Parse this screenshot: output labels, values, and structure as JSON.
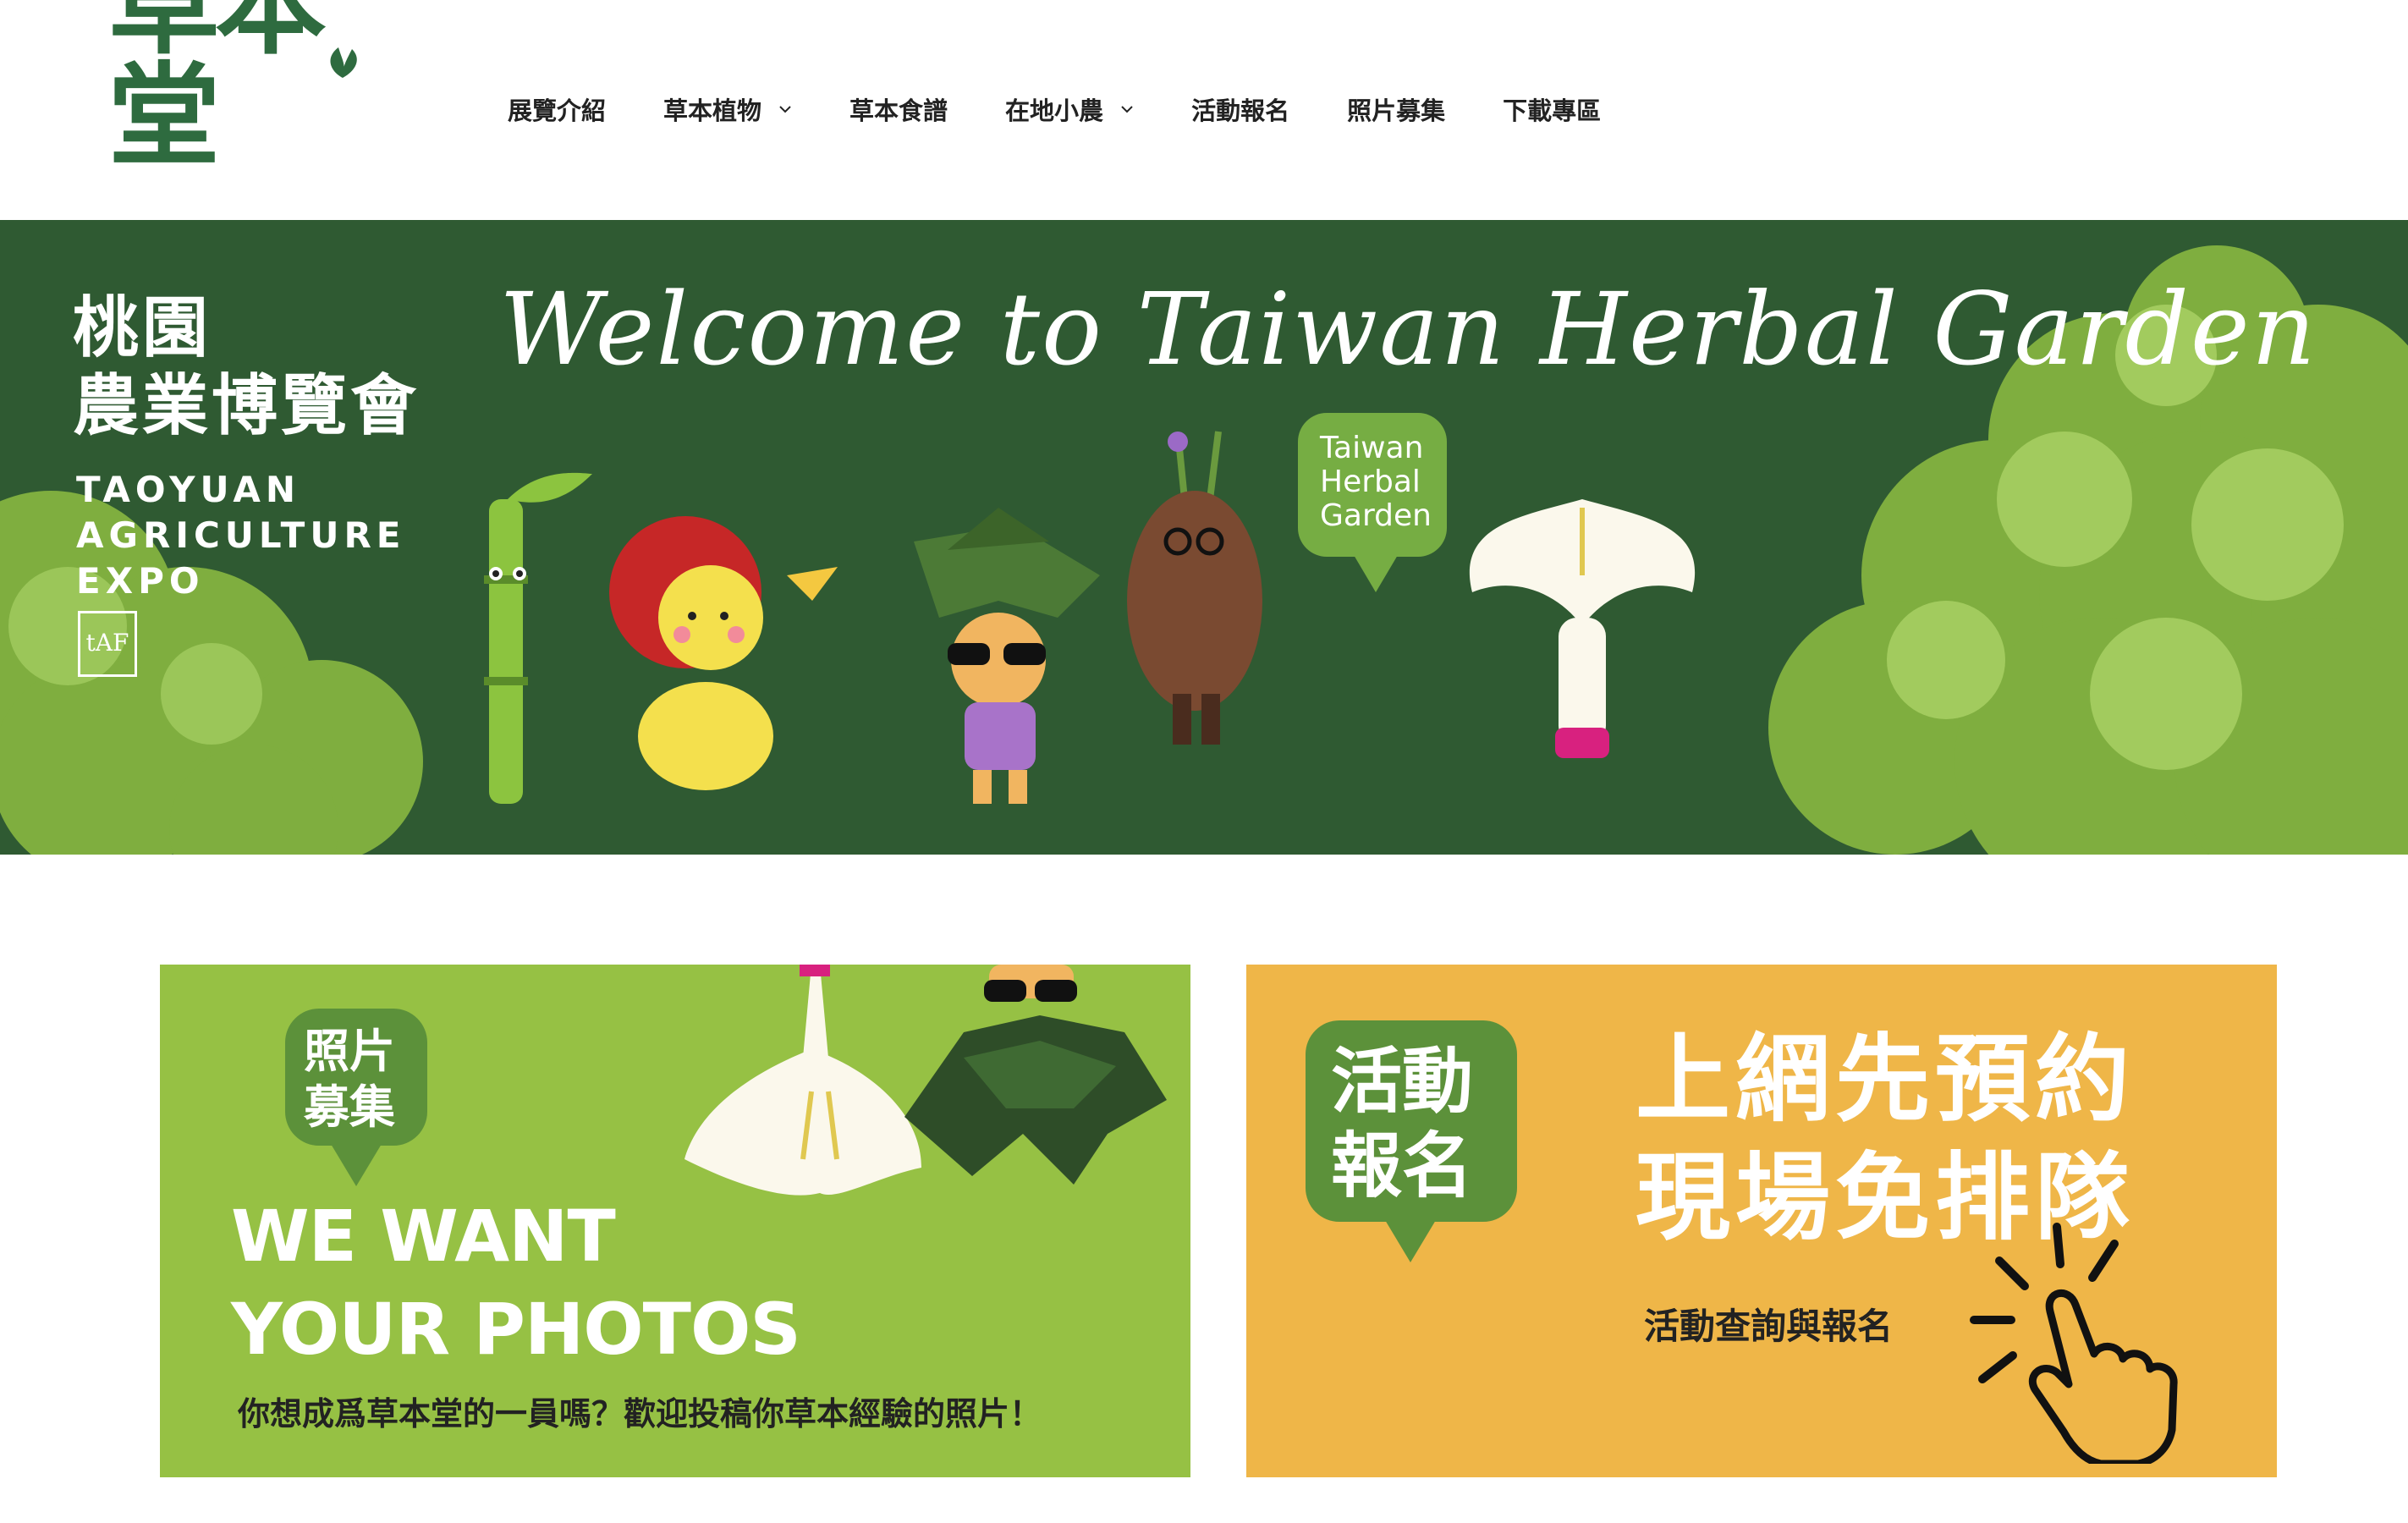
{
  "header": {
    "logo_text": "草本堂",
    "nav": [
      {
        "label": "展覽介紹",
        "has_dropdown": false
      },
      {
        "label": "草本植物",
        "has_dropdown": true
      },
      {
        "label": "草本食譜",
        "has_dropdown": false
      },
      {
        "label": "在地小農",
        "has_dropdown": true
      },
      {
        "label": "活動報名",
        "has_dropdown": false
      },
      {
        "label": "照片募集",
        "has_dropdown": false
      },
      {
        "label": "下載專區",
        "has_dropdown": false
      }
    ]
  },
  "hero": {
    "expo_cn_line1": "桃園",
    "expo_cn_line2": "農業博覽會",
    "expo_en_line1": "TAOYUAN",
    "expo_en_line2": "AGRICULTURE",
    "expo_en_line3": "EXPO",
    "expo_mark": "tAF",
    "welcome": "Welcome to Taiwan Herbal Garden",
    "bubble_line1": "Taiwan",
    "bubble_line2": "Herbal",
    "bubble_line3": "Garden"
  },
  "cards": {
    "photos": {
      "tag_line1": "照片",
      "tag_line2": "募集",
      "headline_line1": "WE WANT",
      "headline_line2": "YOUR PHOTOS",
      "caption": "你想成爲草本堂的一員嗎？歡迎投稿你草本經驗的照片！"
    },
    "events": {
      "tag_line1": "活動",
      "tag_line2": "報名",
      "headline_line1": "上網先預約",
      "headline_line2": "現場免排隊",
      "caption": "活動查詢與報名"
    }
  },
  "colors": {
    "brand_green": "#2e6b3f",
    "hero_bg": "#2f5a32",
    "card_photos": "#96c144",
    "card_events": "#efb648",
    "tag_green": "#5c913a"
  }
}
